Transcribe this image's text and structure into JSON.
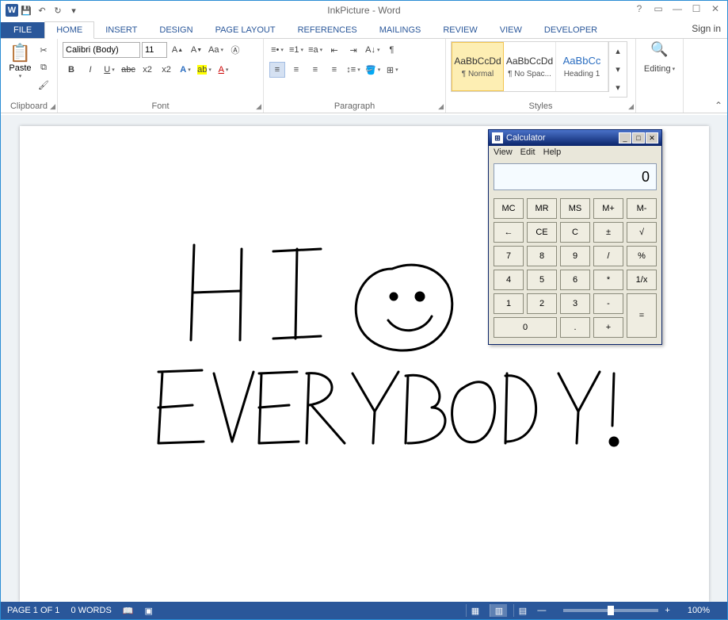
{
  "window": {
    "title": "InkPicture - Word",
    "signin": "Sign in"
  },
  "qat": {
    "save": "💾",
    "undo": "↶",
    "redo": "↻",
    "customize": "▾"
  },
  "tabs": {
    "file": "FILE",
    "home": "HOME",
    "insert": "INSERT",
    "design": "DESIGN",
    "pagelayout": "PAGE LAYOUT",
    "references": "REFERENCES",
    "mailings": "MAILINGS",
    "review": "REVIEW",
    "view": "VIEW",
    "developer": "DEVELOPER"
  },
  "ribbon": {
    "clipboard": {
      "label": "Clipboard",
      "paste": "Paste"
    },
    "font": {
      "label": "Font",
      "name": "Calibri (Body)",
      "size": "11"
    },
    "paragraph": {
      "label": "Paragraph"
    },
    "styles": {
      "label": "Styles",
      "items": [
        {
          "preview": "AaBbCcDd",
          "name": "¶ Normal"
        },
        {
          "preview": "AaBbCcDd",
          "name": "¶ No Spac..."
        },
        {
          "preview": "AaBbCc",
          "name": "Heading 1",
          "heading": true
        }
      ]
    },
    "editing": {
      "label": "Editing",
      "find": "🔍"
    }
  },
  "document": {
    "ink_text_top": "HI",
    "ink_text_bottom": "EVERYBODY!"
  },
  "status": {
    "page": "PAGE 1 OF 1",
    "words": "0 WORDS",
    "zoom": "100%"
  },
  "calc": {
    "title": "Calculator",
    "menu": {
      "view": "View",
      "edit": "Edit",
      "help": "Help"
    },
    "display": "0",
    "rows": [
      [
        "MC",
        "MR",
        "MS",
        "M+",
        "M-"
      ],
      [
        "←",
        "CE",
        "C",
        "±",
        "√"
      ],
      [
        "7",
        "8",
        "9",
        "/",
        "%"
      ],
      [
        "4",
        "5",
        "6",
        "*",
        "1/x"
      ],
      [
        "1",
        "2",
        "3",
        "-",
        "="
      ],
      [
        "0",
        ".",
        "+"
      ]
    ]
  }
}
